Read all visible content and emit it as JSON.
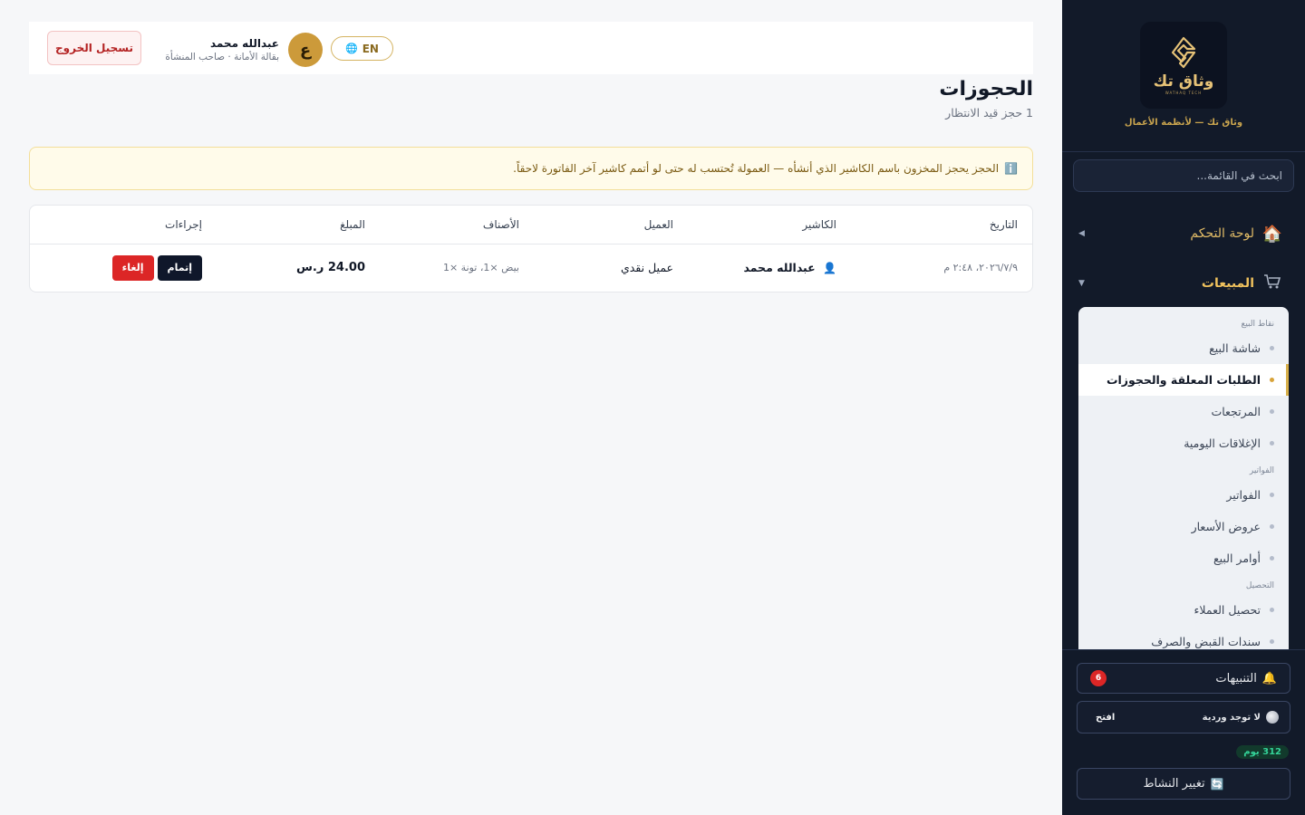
{
  "brand": {
    "logo_text": "وثاق تك",
    "logo_sub": "WATHAQ TECH",
    "tagline": "وثاق تك — لأنظمة الأعمال",
    "accent": "#e1bb66"
  },
  "sidebar": {
    "search_placeholder": "ابحث في القائمة...",
    "nav": [
      {
        "label": "لوحة التحكم",
        "icon": "home-icon"
      },
      {
        "label": "المبيعات",
        "icon": "cart-icon"
      }
    ],
    "groups": [
      {
        "label": "نقاط البيع",
        "items": [
          "شاشة البيع",
          "الطلبات المعلقة والحجوزات",
          "المرتجعات",
          "الإغلاقات اليومية"
        ]
      },
      {
        "label": "الفواتير",
        "items": [
          "الفواتير",
          "عروض الأسعار",
          "أوامر البيع"
        ]
      },
      {
        "label": "التحصيل",
        "items": [
          "تحصيل العملاء",
          "سندات القبض والصرف"
        ]
      }
    ],
    "active_item": "الطلبات المعلقة والحجوزات",
    "footer": {
      "alerts_label": "التنبيهات",
      "alerts_count": "6",
      "shift_status": "لا توجد وردية",
      "open_label": "افتح",
      "days_left": "312 يوم",
      "switch_label": "تغيير النشاط"
    }
  },
  "topbar": {
    "lang_label": "EN",
    "user_name": "عبدالله محمد",
    "user_role": "بقالة الأمانة · صاحب المنشأة",
    "avatar_letter": "ع",
    "logout_label": "تسجيل الخروج"
  },
  "page": {
    "title": "الحجوزات",
    "subtitle": "1 حجز قيد الانتظار",
    "notice": "الحجز يحجز المخزون باسم الكاشير الذي أنشأه — العمولة تُحتسب له حتى لو أتمم كاشير آخر الفاتورة لاحقاً."
  },
  "table": {
    "columns": [
      "التاريخ",
      "الكاشير",
      "العميل",
      "الأصناف",
      "المبلغ",
      "إجراءات"
    ],
    "rows": [
      {
        "date": "٢٠٢٦/٧/٩، ٢:٤٨ م",
        "cashier": "عبدالله محمد",
        "customer": "عميل نقدي",
        "items": "بيض ×1، تونة ×1",
        "amount": "24.00 ر.س",
        "complete_label": "إتمام",
        "cancel_label": "إلغاء"
      }
    ]
  }
}
